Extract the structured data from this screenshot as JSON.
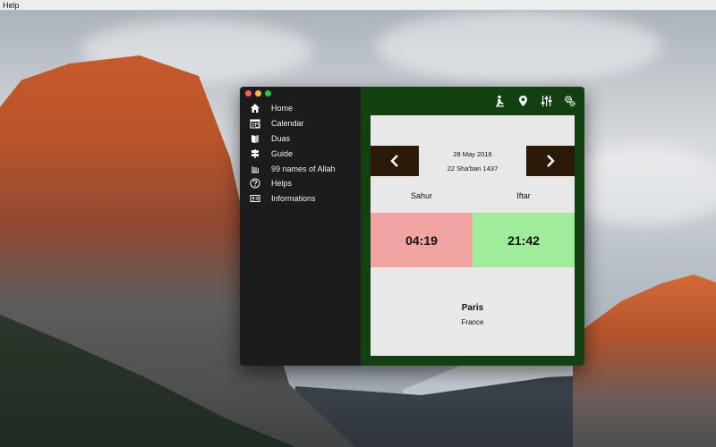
{
  "menubar": {
    "help": "Help"
  },
  "window": {
    "sidebar": {
      "items": [
        {
          "label": "Home",
          "icon": "home-icon"
        },
        {
          "label": "Calendar",
          "icon": "calendar-icon"
        },
        {
          "label": "Duas",
          "icon": "book-icon"
        },
        {
          "label": "Guide",
          "icon": "signpost-icon"
        },
        {
          "label": "99 names of Allah",
          "icon": "allah-calligraphy-icon"
        },
        {
          "label": "Helps",
          "icon": "question-icon"
        },
        {
          "label": "Informations",
          "icon": "id-card-icon"
        }
      ]
    },
    "toolbar": {
      "icons": [
        "prayer-icon",
        "location-pin-icon",
        "sliders-icon",
        "gears-icon"
      ]
    },
    "date": {
      "gregorian": "28 May 2016",
      "hijri": "22 Sha'ban 1437"
    },
    "times": {
      "sahur_label": "Sahur",
      "iftar_label": "Iftar",
      "sahur_time": "04:19",
      "iftar_time": "21:42"
    },
    "location": {
      "city": "Paris",
      "country": "France"
    }
  },
  "colors": {
    "sidebar_bg": "#1c1c1d",
    "main_bg": "#124010",
    "nav_button": "#2b1a08",
    "sahur_bg": "#f2a4a2",
    "iftar_bg": "#9fec9a",
    "panel_bg": "#e8e8e8"
  }
}
